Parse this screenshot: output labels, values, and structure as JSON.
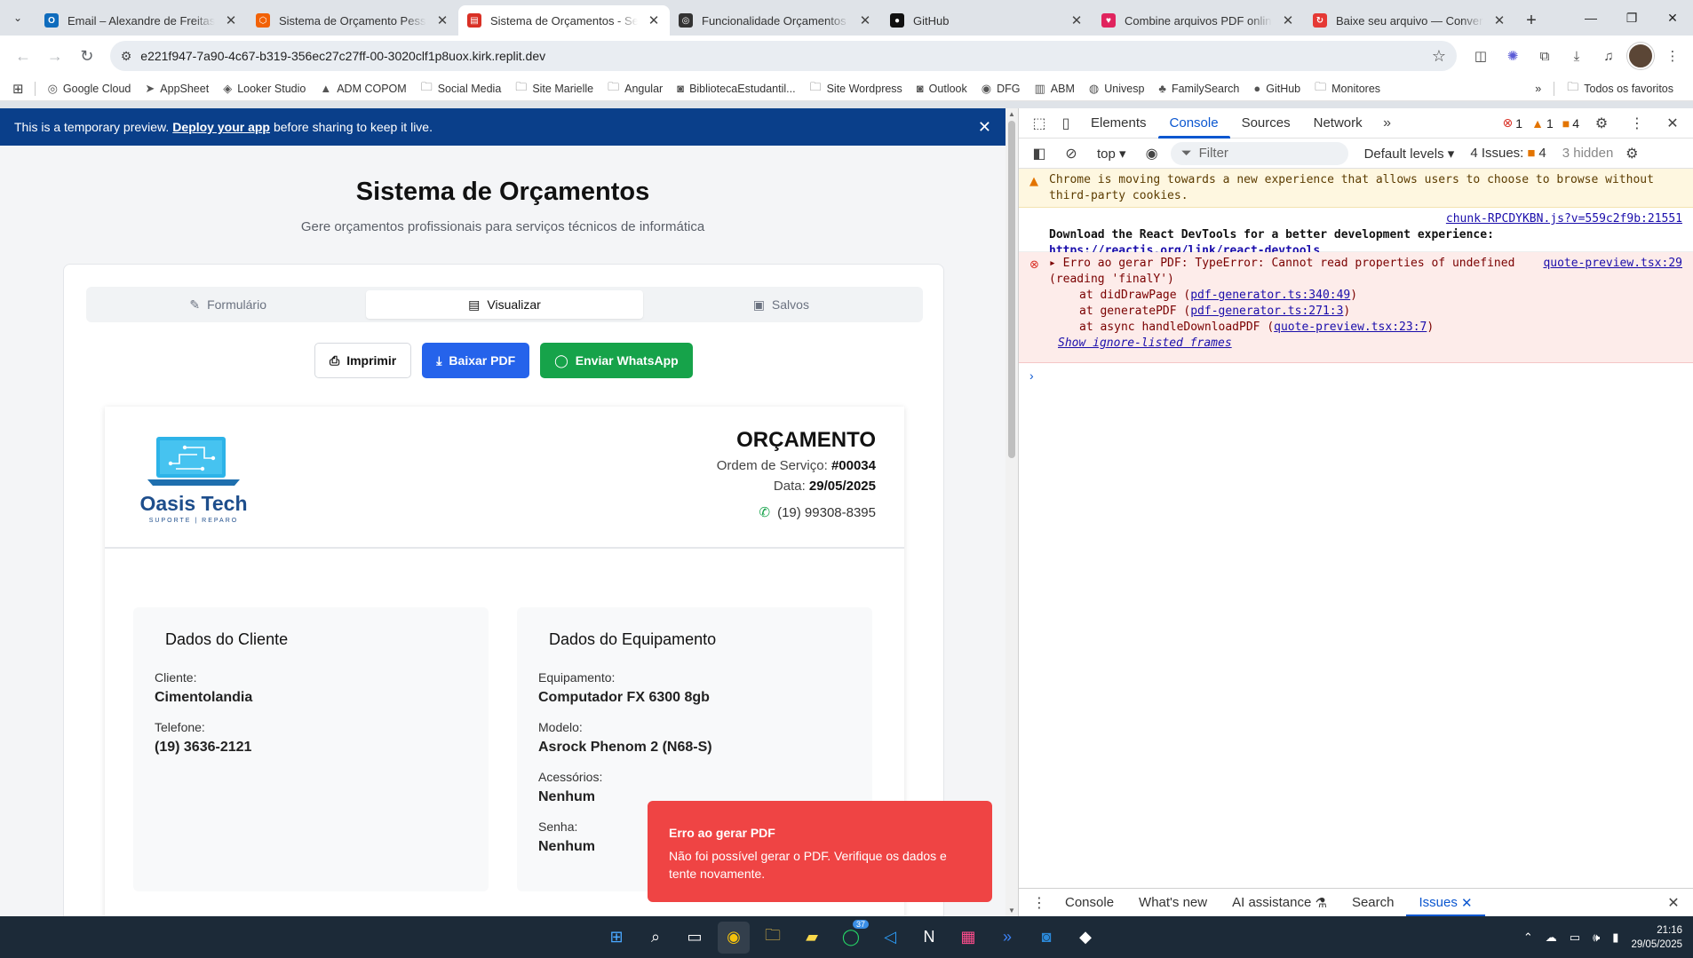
{
  "browser": {
    "tabs": [
      {
        "title": "Email – Alexandre de Freitas Fil",
        "fav_color": "#0f6cbd",
        "fav_glyph": "O"
      },
      {
        "title": "Sistema de Orçamento Pessoal",
        "fav_color": "#f26207",
        "fav_glyph": "⬡"
      },
      {
        "title": "Sistema de Orçamentos - Servi",
        "fav_color": "#d93025",
        "fav_glyph": "▤"
      },
      {
        "title": "Funcionalidade Orçamentos Sa",
        "fav_color": "#333333",
        "fav_glyph": "◎"
      },
      {
        "title": "GitHub",
        "fav_color": "#111111",
        "fav_glyph": "●"
      },
      {
        "title": "Combine arquivos PDF online.",
        "fav_color": "#e0245e",
        "fav_glyph": "♥"
      },
      {
        "title": "Baixe seu arquivo — Convertio",
        "fav_color": "#e53935",
        "fav_glyph": "↻"
      }
    ],
    "url": "e221f947-7a90-4c67-b319-356ec27c27ff-00-3020clf1p8uox.kirk.replit.dev",
    "bookmarks": [
      "Google Cloud",
      "AppSheet",
      "Looker Studio",
      "ADM COPOM",
      "Social Media",
      "Site Marielle",
      "Angular",
      "BibliotecaEstudantil...",
      "Site Wordpress",
      "Outlook",
      "DFG",
      "ABM",
      "Univesp",
      "FamilySearch",
      "GitHub",
      "Monitores"
    ],
    "bookmarks_more": "»",
    "all_bookmarks": "Todos os favoritos"
  },
  "banner": {
    "text": "This is a temporary preview.",
    "link": "Deploy your app",
    "text_after": "before sharing to keep it live."
  },
  "app": {
    "title": "Sistema de Orçamentos",
    "subtitle": "Gere orçamentos profissionais para serviços técnicos de informática",
    "tabs": [
      "Formulário",
      "Visualizar",
      "Salvos"
    ],
    "actions": {
      "print": "Imprimir",
      "download": "Baixar PDF",
      "whatsapp": "Enviar WhatsApp"
    }
  },
  "quote": {
    "company": "Oasis Tech",
    "company_tagline": "SUPORTE | REPARO",
    "title": "ORÇAMENTO",
    "os_label": "Ordem de Serviço:",
    "os_number": "#00034",
    "date_label": "Data:",
    "date": "29/05/2025",
    "phone": "(19) 99308-8395",
    "client": {
      "heading": "Dados do Cliente",
      "fields": [
        {
          "label": "Cliente:",
          "value": "Cimentolandia"
        },
        {
          "label": "Telefone:",
          "value": "(19) 3636-2121"
        }
      ]
    },
    "equipment": {
      "heading": "Dados do Equipamento",
      "fields": [
        {
          "label": "Equipamento:",
          "value": "Computador FX 6300 8gb"
        },
        {
          "label": "Modelo:",
          "value": "Asrock Phenom 2 (N68-S)"
        },
        {
          "label": "Acessórios:",
          "value": "Nenhum"
        },
        {
          "label": "Senha:",
          "value": "Nenhum"
        }
      ]
    }
  },
  "toast": {
    "title": "Erro ao gerar PDF",
    "message": "Não foi possível gerar o PDF. Verifique os dados e tente novamente."
  },
  "devtools": {
    "tabs": [
      "Elements",
      "Console",
      "Sources",
      "Network"
    ],
    "badges": {
      "errors": "1",
      "warnings": "1",
      "issues": "4"
    },
    "context": "top",
    "filter_placeholder": "Filter",
    "levels": "Default levels",
    "issues_label": "4 Issues:",
    "issues_count": "4",
    "hidden": "3 hidden",
    "warning": "Chrome is moving towards a new experience that allows users to choose to browse without third-party cookies.",
    "info_source": "chunk-RPCDYKBN.js?v=559c2f9b:21551",
    "info_text": "Download the React DevTools for a better development experience:",
    "info_link": "https://reactjs.org/link/react-devtools",
    "error_source": "quote-preview.tsx:29",
    "error_text": "Erro ao gerar PDF: TypeError: Cannot read properties of undefined (reading 'finalY')",
    "stack": [
      {
        "prefix": "at didDrawPage (",
        "link": "pdf-generator.ts:340:49",
        "suffix": ")"
      },
      {
        "prefix": "at generatePDF (",
        "link": "pdf-generator.ts:271:3",
        "suffix": ")"
      },
      {
        "prefix": "at async handleDownloadPDF (",
        "link": "quote-preview.tsx:23:7",
        "suffix": ")"
      }
    ],
    "ignore_listed": "Show ignore-listed frames",
    "drawer_tabs": [
      "Console",
      "What's new",
      "AI assistance",
      "Search",
      "Issues"
    ]
  },
  "taskbar": {
    "whatsapp_badge": "37",
    "time": "21:16",
    "date": "29/05/2025"
  }
}
